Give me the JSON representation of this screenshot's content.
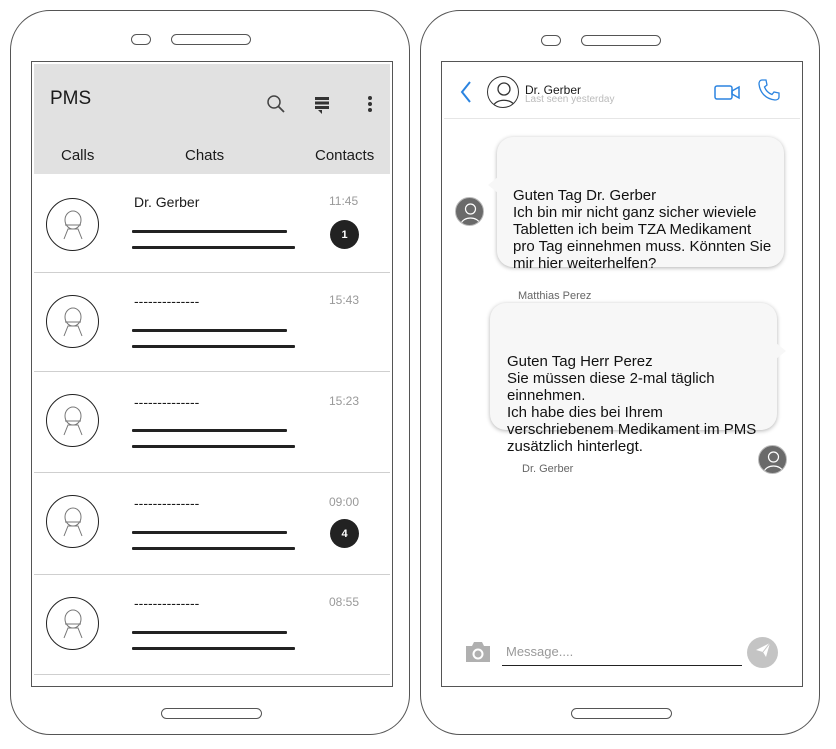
{
  "chat_list": {
    "app_title": "PMS",
    "icons": [
      "search-icon",
      "stack-icon",
      "more-vertical-icon"
    ],
    "tabs": [
      {
        "label": "Calls"
      },
      {
        "label": "Chats"
      },
      {
        "label": "Contacts"
      }
    ],
    "items": [
      {
        "name": "Dr. Gerber",
        "time": "11:45",
        "badge": "1"
      },
      {
        "name": "--------------",
        "time": "15:43",
        "badge": ""
      },
      {
        "name": "--------------",
        "time": "15:23",
        "badge": ""
      },
      {
        "name": "--------------",
        "time": "09:00",
        "badge": "4"
      },
      {
        "name": "--------------",
        "time": "08:55",
        "badge": ""
      }
    ]
  },
  "conversation": {
    "back_icon": "chevron-left-icon",
    "contact_name": "Dr. Gerber",
    "last_seen": "Last seen yesterday",
    "header_icons": [
      "video-call-icon",
      "phone-icon"
    ],
    "messages": [
      {
        "sender": "Matthias Perez",
        "text": "Guten Tag Dr. Gerber\nIch bin mir nicht ganz sicher wieviele Tabletten ich beim TZA Medikament pro Tag einnehmen muss. Könnten Sie mir hier weiterhelfen?"
      },
      {
        "sender": "Dr. Gerber",
        "text": "Guten Tag Herr Perez\nSie müssen diese 2-mal täglich einnehmen.\nIch habe dies bei Ihrem verschriebenem Medikament im PMS zusätzlich hinterlegt."
      }
    ],
    "input_placeholder": "Message....",
    "camera_icon": "camera-icon",
    "send_icon": "send-icon"
  },
  "colors": {
    "accent_blue": "#2b84e0",
    "header_gray": "#e1e1e1",
    "badge_dark": "#222222",
    "bubble_bg": "#f7f7f7"
  }
}
